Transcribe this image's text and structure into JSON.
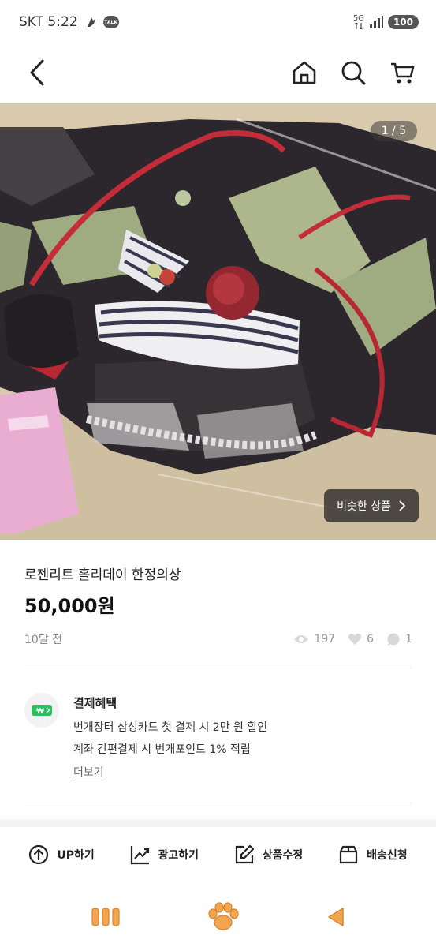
{
  "status_bar": {
    "carrier_time": "SKT 5:22",
    "talk_badge": "TALK",
    "network": "5G",
    "battery": "100"
  },
  "nav": {
    "back_icon": "chevron-left-icon",
    "home_icon": "home-icon",
    "search_icon": "search-icon",
    "cart_icon": "cart-icon"
  },
  "gallery": {
    "page_indicator": "1 / 5",
    "similar_label": "비슷한 상품"
  },
  "product": {
    "title": "로젠리트 홀리데이 한정의상",
    "price": "50,000원",
    "posted": "10달 전",
    "views": "197",
    "likes": "6",
    "chats": "1"
  },
  "benefit": {
    "title": "결제혜택",
    "line1": "번개장터 삼성카드 첫 결제 시 2만 원  할인",
    "line2": "계좌 간편결제 시 번개포인트 1% 적립",
    "more": "더보기"
  },
  "actions": [
    {
      "label": "UP하기",
      "icon": "arrow-up-circle-icon"
    },
    {
      "label": "광고하기",
      "icon": "chart-trend-icon"
    },
    {
      "label": "상품수정",
      "icon": "edit-icon"
    },
    {
      "label": "배송신청",
      "icon": "box-icon"
    }
  ],
  "colors": {
    "accent_green": "#2dbe60",
    "nav_icon_orange": "#f0a24a"
  }
}
